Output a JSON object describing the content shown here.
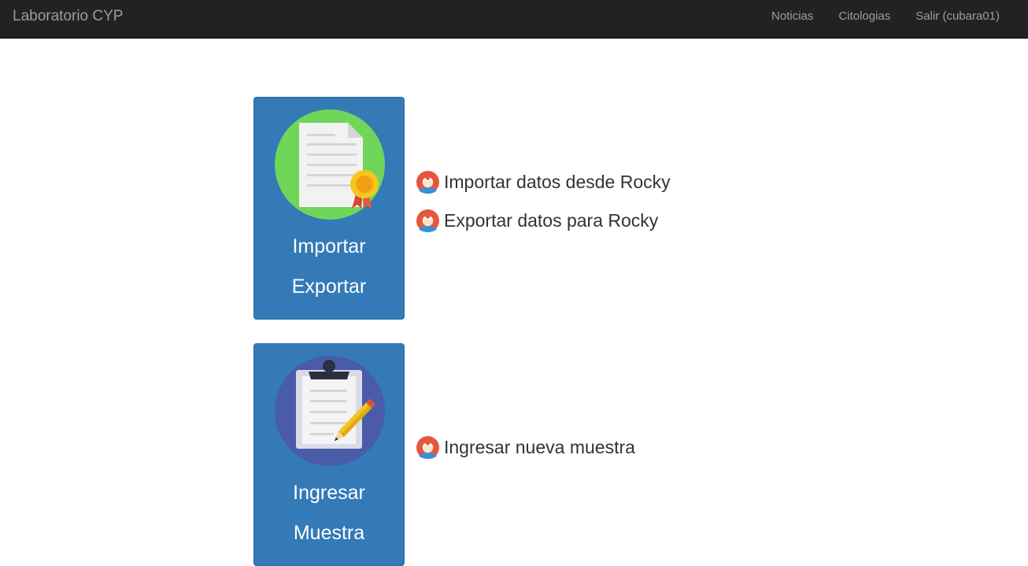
{
  "navbar": {
    "brand": "Laboratorio CYP",
    "links": [
      "Noticias",
      "Citologias",
      "Salir (cubara01)"
    ]
  },
  "cards": [
    {
      "line1": "Importar",
      "line2": "Exportar",
      "icon": "certificate-icon",
      "circle_color": "#6fd65a",
      "actions": [
        "Importar datos desde Rocky",
        "Exportar datos para Rocky"
      ]
    },
    {
      "line1": "Ingresar",
      "line2": "Muestra",
      "icon": "clipboard-icon",
      "circle_color": "#4a5ba8",
      "actions": [
        "Ingresar nueva muestra"
      ]
    }
  ],
  "colors": {
    "navbar": "#222222",
    "nav_text": "#9d9d9d",
    "card": "#337ab7",
    "link_text": "#333333"
  }
}
